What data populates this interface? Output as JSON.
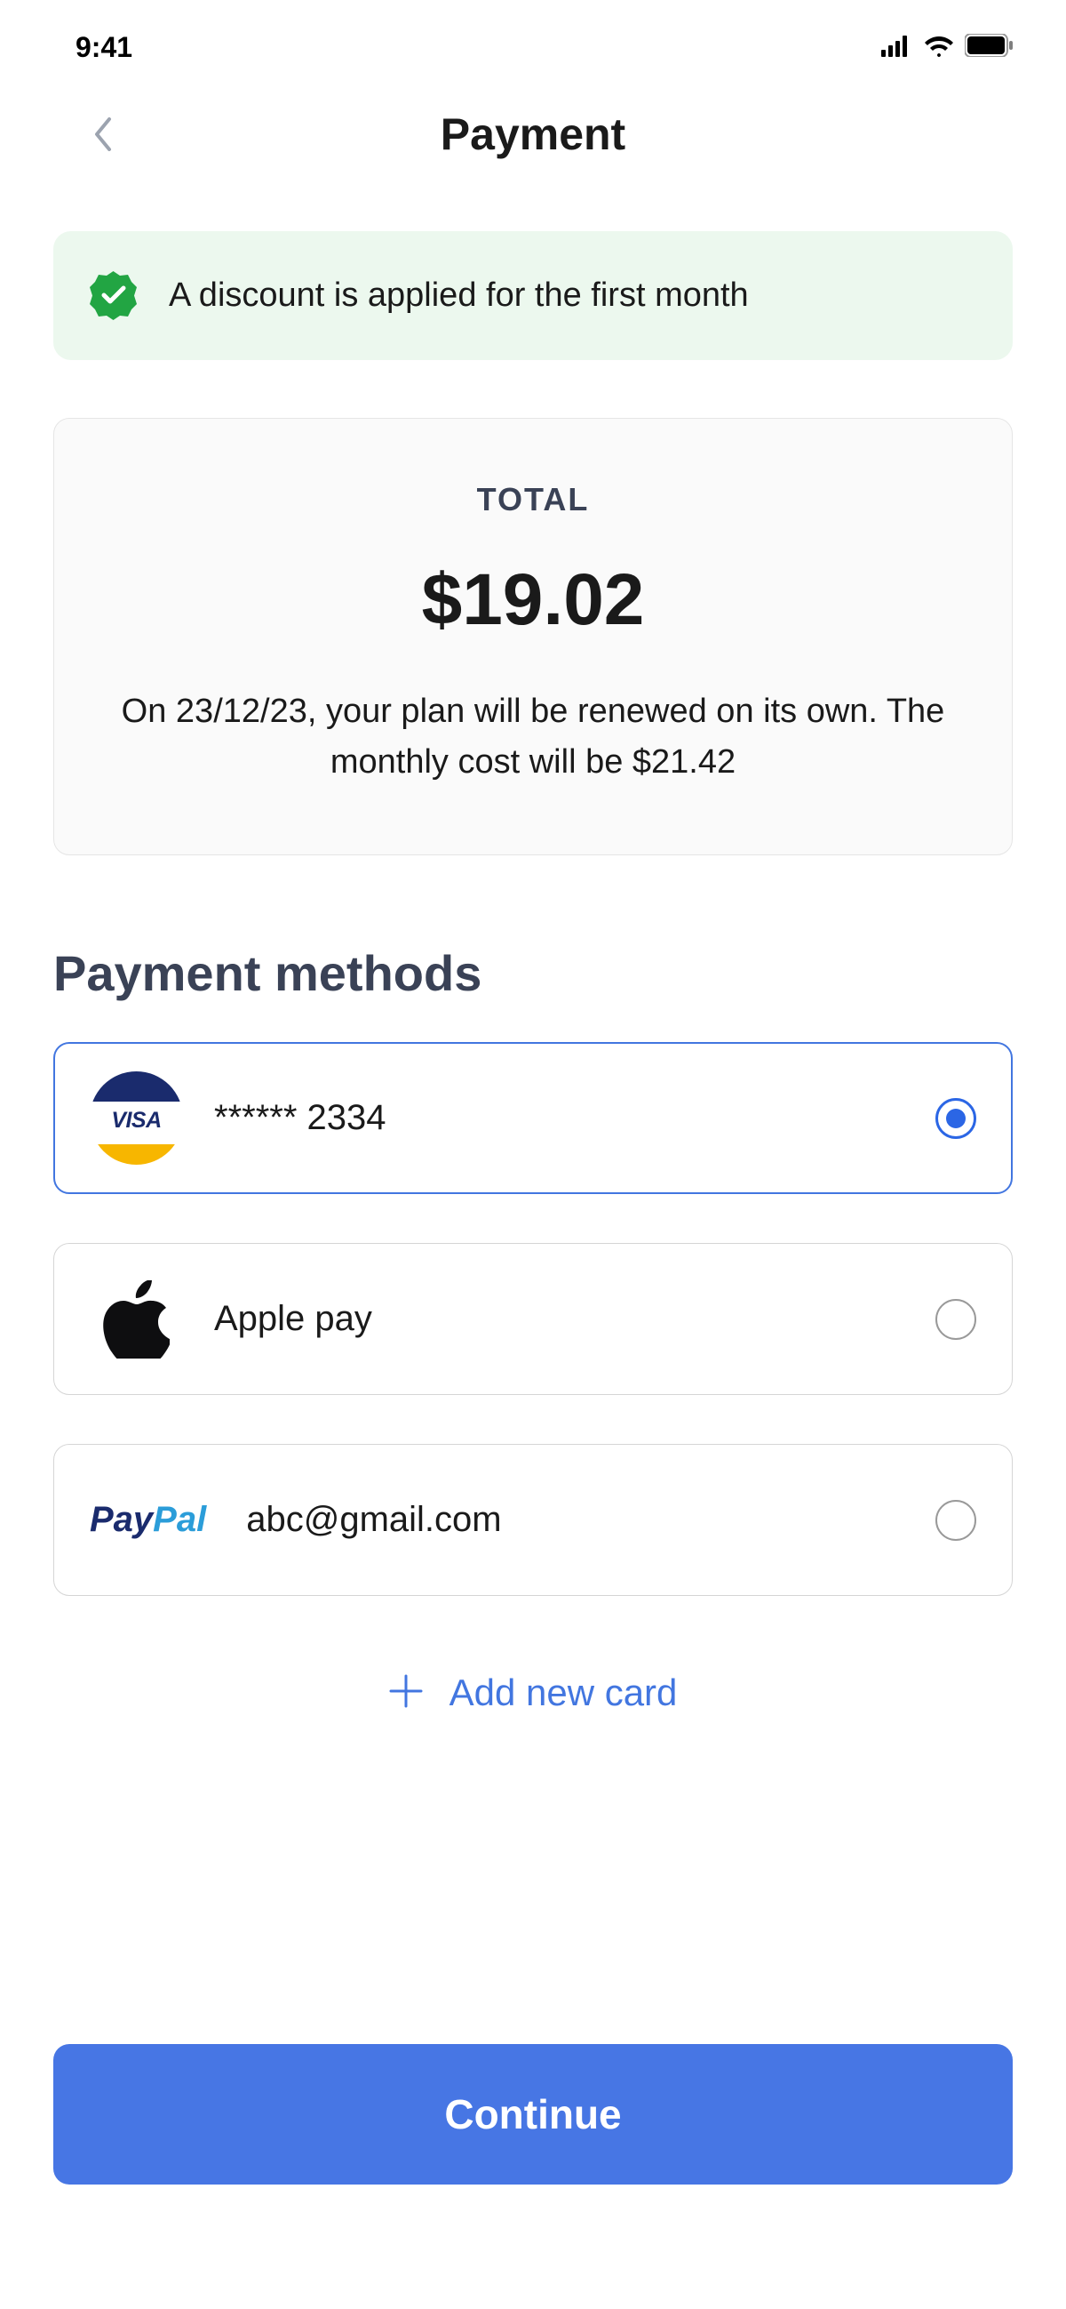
{
  "status": {
    "time": "9:41"
  },
  "header": {
    "title": "Payment"
  },
  "banner": {
    "text": "A discount is applied for the first month"
  },
  "total": {
    "label": "TOTAL",
    "amount": "$19.02",
    "renewal": "On 23/12/23, your plan will be renewed on its own. The monthly cost will be $21.42"
  },
  "section": {
    "title": "Payment methods"
  },
  "methods": {
    "visa": {
      "brand": "VISA",
      "masked": "****** 2334",
      "selected": true
    },
    "apple": {
      "label": "Apple pay",
      "selected": false
    },
    "paypal": {
      "brand_pay": "Pay",
      "brand_pal": "Pal",
      "email": "abc@gmail.com",
      "selected": false
    }
  },
  "add_card": {
    "label": "Add new card"
  },
  "continue": {
    "label": "Continue"
  }
}
